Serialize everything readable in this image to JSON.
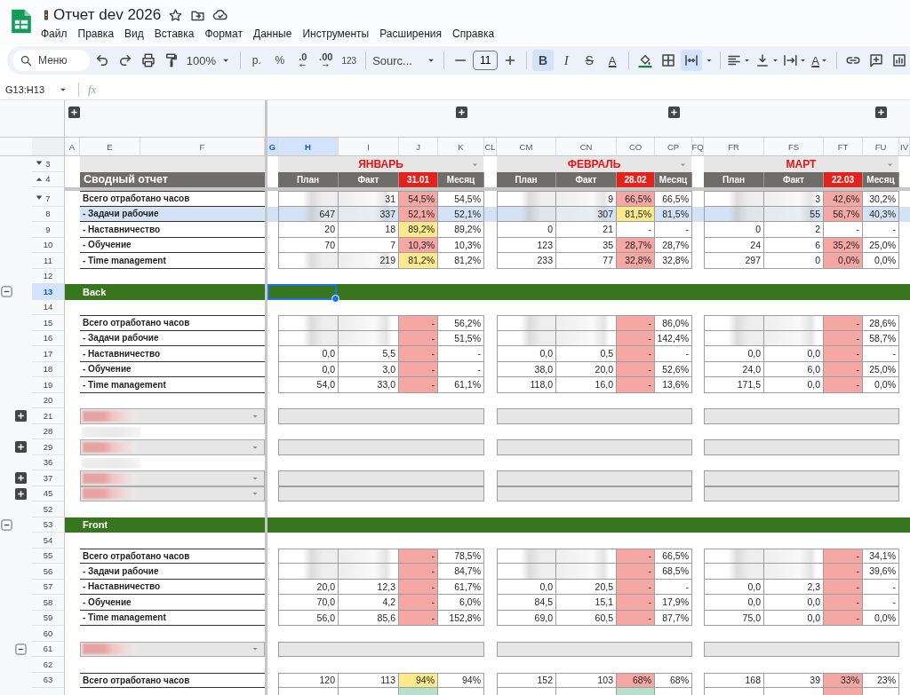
{
  "app": {
    "title": "Отчет dev 2026",
    "menu": [
      "Файл",
      "Правка",
      "Вид",
      "Вставка",
      "Формат",
      "Данные",
      "Инструменты",
      "Расширения",
      "Справка"
    ]
  },
  "toolbar": {
    "search_placeholder": "Меню",
    "zoom": "100%",
    "currency": "р.",
    "percent": "%",
    "decrease_decimals": ".0",
    "increase_decimals": ".00",
    "number_format": "123",
    "font": "Sourc...",
    "font_size": "11",
    "bold": {
      "label": "B",
      "selected": true
    },
    "italic": {
      "label": "I",
      "selected": false
    },
    "strikethrough": {
      "label": "S",
      "selected": false
    },
    "text_color": "A",
    "merge_selected": true,
    "text_rotation": "A"
  },
  "formula_bar": {
    "name_box": "G13:H13",
    "fx": "fx"
  },
  "column_groups": [
    {
      "collapsed": true
    },
    {
      "collapsed": true
    },
    {
      "collapsed": true
    },
    {
      "collapsed": true
    }
  ],
  "columns": [
    {
      "label": "A",
      "selected": false
    },
    {
      "label": "E",
      "selected": false
    },
    {
      "label": "F",
      "selected": false
    },
    {
      "label": "G",
      "selected": true
    },
    {
      "label": "H",
      "selected": true
    },
    {
      "label": "I",
      "selected": false
    },
    {
      "label": "J",
      "selected": false
    },
    {
      "label": "K",
      "selected": false
    },
    {
      "label": "CL",
      "selected": false
    },
    {
      "label": "CM",
      "selected": false
    },
    {
      "label": "CN",
      "selected": false
    },
    {
      "label": "CO",
      "selected": false
    },
    {
      "label": "CP",
      "selected": false
    },
    {
      "label": "FQ",
      "selected": false
    },
    {
      "label": "FR",
      "selected": false
    },
    {
      "label": "FS",
      "selected": false
    },
    {
      "label": "FT",
      "selected": false
    },
    {
      "label": "FU",
      "selected": false
    },
    {
      "label": "IV",
      "selected": false
    }
  ],
  "report_title": "Сводный отчет",
  "months": [
    {
      "name": "ЯНВАРЬ",
      "headers": [
        {
          "label": "План",
          "highlight": false
        },
        {
          "label": "Факт",
          "highlight": false
        },
        {
          "label": "31.01",
          "highlight": true
        },
        {
          "label": "Месяц",
          "highlight": false
        }
      ]
    },
    {
      "name": "ФЕВРАЛЬ",
      "headers": [
        {
          "label": "План",
          "highlight": false
        },
        {
          "label": "Факт",
          "highlight": false
        },
        {
          "label": "28.02",
          "highlight": true
        },
        {
          "label": "Месяц",
          "highlight": false
        }
      ]
    },
    {
      "name": "МАРТ",
      "headers": [
        {
          "label": "План",
          "highlight": false
        },
        {
          "label": "Факт",
          "highlight": false
        },
        {
          "label": "22.03",
          "highlight": true
        },
        {
          "label": "Месяц",
          "highlight": false
        }
      ]
    }
  ],
  "rows": [
    {
      "number": "3",
      "kind": "month_titles",
      "toggle": {
        "kind": "down"
      },
      "selected": false,
      "highlighted": false
    },
    {
      "number": "4",
      "kind": "month_headers",
      "toggle": {
        "kind": "up"
      },
      "selected": false,
      "highlighted": false
    },
    {
      "number": "7",
      "kind": "metric",
      "toggle": {
        "kind": "down"
      },
      "selected": false,
      "highlighted": false,
      "label": "Всего отработано часов",
      "months": [
        {
          "fact": "31",
          "pct": "54,5%",
          "month": "54,5%",
          "color": "#f4a7a3",
          "blurred": true
        },
        {
          "fact": "9",
          "pct": "66,5%",
          "month": "66,5%",
          "color": "#f4a7a3",
          "blurred": true
        },
        {
          "fact": "3",
          "pct": "42,6%",
          "month": "30,2%",
          "color": "#f4a7a3",
          "blurred": true
        }
      ]
    },
    {
      "number": "8",
      "kind": "metric",
      "selected": false,
      "highlighted": true,
      "label": "- Задачи рабочие",
      "months": [
        {
          "plan": "647",
          "fact": "337",
          "pct": "52,1%",
          "month": "52,1%",
          "color": "#f4a7a3",
          "blurred": true
        },
        {
          "fact": "307",
          "pct": "81,5%",
          "month": "81,5%",
          "color": "#fce98c",
          "blurred": true
        },
        {
          "fact": "55",
          "pct": "56,7%",
          "month": "40,3%",
          "color": "#f4a7a3",
          "blurred": true
        }
      ]
    },
    {
      "number": "9",
      "kind": "metric",
      "selected": false,
      "highlighted": false,
      "label": "- Наставничество",
      "months": [
        {
          "plan": "20",
          "fact": "18",
          "pct": "89,2%",
          "month": "89,2%",
          "color": "#fce98c",
          "blurred": false
        },
        {
          "plan": "0",
          "fact": "21",
          "pct": "-",
          "month": "-",
          "blurred": false
        },
        {
          "plan": "0",
          "fact": "2",
          "pct": "-",
          "month": "-",
          "blurred": false
        }
      ]
    },
    {
      "number": "10",
      "kind": "metric",
      "selected": false,
      "highlighted": false,
      "label": "- Обучение",
      "months": [
        {
          "plan": "70",
          "fact": "7",
          "pct": "10,3%",
          "month": "10,3%",
          "color": "#f4a7a3",
          "blurred": false
        },
        {
          "plan": "123",
          "fact": "35",
          "pct": "28,7%",
          "month": "28,7%",
          "color": "#f4a7a3",
          "blurred": false
        },
        {
          "plan": "24",
          "fact": "6",
          "pct": "35,2%",
          "month": "25,0%",
          "color": "#f4a7a3",
          "blurred": false
        }
      ]
    },
    {
      "number": "11",
      "kind": "metric",
      "selected": false,
      "highlighted": false,
      "label": "- Time management",
      "months": [
        {
          "fact": "219",
          "pct": "81,2%",
          "month": "81,2%",
          "color": "#fce98c",
          "blurred": true
        },
        {
          "plan": "233",
          "fact": "77",
          "pct": "32,8%",
          "month": "32,8%",
          "color": "#f4a7a3",
          "blurred": false
        },
        {
          "plan": "297",
          "fact": "0",
          "pct": "0,0%",
          "month": "0,0%",
          "color": "#f4a7a3",
          "blurred": false
        }
      ]
    },
    {
      "number": "12",
      "kind": "blank",
      "selected": false,
      "highlighted": false
    },
    {
      "number": "13",
      "kind": "section",
      "outline": {
        "expanded": true
      },
      "selected": true,
      "highlighted": false,
      "label": "Back"
    },
    {
      "number": "14",
      "kind": "blank",
      "selected": false,
      "highlighted": false
    },
    {
      "number": "15",
      "kind": "metric",
      "selected": false,
      "highlighted": false,
      "label": "Всего отработано часов",
      "months": [
        {
          "pct": "-",
          "month": "56,2%",
          "color": "#f4a7a3",
          "blurred": true
        },
        {
          "pct": "-",
          "month": "86,0%",
          "color": "#f4a7a3",
          "blurred": true
        },
        {
          "pct": "-",
          "month": "28,6%",
          "color": "#f4a7a3",
          "blurred": true
        }
      ]
    },
    {
      "number": "16",
      "kind": "metric",
      "selected": false,
      "highlighted": false,
      "label": "- Задачи рабочие",
      "months": [
        {
          "pct": "-",
          "month": "51,5%",
          "color": "#f4a7a3",
          "blurred": true
        },
        {
          "pct": "-",
          "month": "142,4%",
          "color": "#f4a7a3",
          "blurred": true
        },
        {
          "pct": "-",
          "month": "58,7%",
          "color": "#f4a7a3",
          "blurred": true
        }
      ]
    },
    {
      "number": "17",
      "kind": "metric",
      "selected": false,
      "highlighted": false,
      "label": "- Наставничество",
      "months": [
        {
          "plan": "0,0",
          "fact": "5,5",
          "pct": "-",
          "month": "-",
          "color": "#f4a7a3",
          "blurred": false
        },
        {
          "plan": "0,0",
          "fact": "0,5",
          "pct": "-",
          "month": "-",
          "color": "#f4a7a3",
          "blurred": false
        },
        {
          "plan": "0,0",
          "fact": "0,0",
          "pct": "-",
          "month": "-",
          "color": "#f4a7a3",
          "blurred": false
        }
      ]
    },
    {
      "number": "18",
      "kind": "metric",
      "selected": false,
      "highlighted": false,
      "label": "- Обучение",
      "months": [
        {
          "plan": "0,0",
          "fact": "3,0",
          "pct": "-",
          "month": "-",
          "color": "#f4a7a3",
          "blurred": false
        },
        {
          "plan": "38,0",
          "fact": "20,0",
          "pct": "-",
          "month": "52,6%",
          "color": "#f4a7a3",
          "blurred": false
        },
        {
          "plan": "24,0",
          "fact": "6,0",
          "pct": "-",
          "month": "25,0%",
          "color": "#f4a7a3",
          "blurred": false
        }
      ]
    },
    {
      "number": "19",
      "kind": "metric",
      "selected": false,
      "highlighted": false,
      "label": "- Time management",
      "months": [
        {
          "plan": "54,0",
          "fact": "33,0",
          "pct": "-",
          "month": "61,1%",
          "color": "#f4a7a3",
          "blurred": false
        },
        {
          "plan": "118,0",
          "fact": "16,0",
          "pct": "-",
          "month": "13,6%",
          "color": "#f4a7a3",
          "blurred": false
        },
        {
          "plan": "171,5",
          "fact": "0,0",
          "pct": "-",
          "month": "0,0%",
          "color": "#f4a7a3",
          "blurred": false
        }
      ]
    },
    {
      "number": "20",
      "kind": "blank",
      "selected": false,
      "highlighted": false
    },
    {
      "number": "21",
      "kind": "group",
      "outline": {
        "expanded": false
      },
      "blurred": true,
      "selected": false,
      "highlighted": false
    },
    {
      "number": "28",
      "kind": "blank",
      "blurred": true,
      "selected": false,
      "highlighted": false
    },
    {
      "number": "29",
      "kind": "group",
      "outline": {
        "expanded": false
      },
      "blurred": true,
      "selected": false,
      "highlighted": false
    },
    {
      "number": "36",
      "kind": "blank",
      "blurred": true,
      "selected": false,
      "highlighted": false
    },
    {
      "number": "37",
      "kind": "group",
      "outline": {
        "expanded": false
      },
      "blurred": true,
      "selected": false,
      "highlighted": false
    },
    {
      "number": "45",
      "kind": "group",
      "outline": {
        "expanded": false
      },
      "blurred": true,
      "selected": false,
      "highlighted": false
    },
    {
      "number": "52",
      "kind": "blank",
      "selected": false,
      "highlighted": false
    },
    {
      "number": "53",
      "kind": "section",
      "outline": {
        "expanded": true
      },
      "selected": false,
      "highlighted": false,
      "label": "Front"
    },
    {
      "number": "54",
      "kind": "blank",
      "selected": false,
      "highlighted": false
    },
    {
      "number": "55",
      "kind": "metric",
      "selected": false,
      "highlighted": false,
      "label": "Всего отработано часов",
      "months": [
        {
          "pct": "-",
          "month": "78,5%",
          "color": "#f4a7a3",
          "blurred": true
        },
        {
          "pct": "-",
          "month": "66,5%",
          "color": "#f4a7a3",
          "blurred": true
        },
        {
          "pct": "-",
          "month": "34,1%",
          "color": "#f4a7a3",
          "blurred": true
        }
      ]
    },
    {
      "number": "56",
      "kind": "metric",
      "selected": false,
      "highlighted": false,
      "label": "- Задачи рабочие",
      "months": [
        {
          "pct": "-",
          "month": "84,7%",
          "color": "#f4a7a3",
          "blurred": true
        },
        {
          "pct": "-",
          "month": "68,5%",
          "color": "#f4a7a3",
          "blurred": true
        },
        {
          "pct": "-",
          "month": "39,6%",
          "color": "#f4a7a3",
          "blurred": true
        }
      ]
    },
    {
      "number": "57",
      "kind": "metric",
      "selected": false,
      "highlighted": false,
      "label": "- Наставничество",
      "months": [
        {
          "plan": "20,0",
          "fact": "12,3",
          "pct": "-",
          "month": "61,7%",
          "color": "#f4a7a3",
          "blurred": false
        },
        {
          "plan": "0,0",
          "fact": "20,5",
          "pct": "-",
          "month": "-",
          "color": "#f4a7a3",
          "blurred": false
        },
        {
          "plan": "0,0",
          "fact": "2,3",
          "pct": "-",
          "month": "-",
          "color": "#f4a7a3",
          "blurred": false
        }
      ]
    },
    {
      "number": "58",
      "kind": "metric",
      "selected": false,
      "highlighted": false,
      "label": "- Обучение",
      "months": [
        {
          "plan": "70,0",
          "fact": "4,2",
          "pct": "-",
          "month": "6,0%",
          "color": "#f4a7a3",
          "blurred": false
        },
        {
          "plan": "84,5",
          "fact": "15,1",
          "pct": "-",
          "month": "17,9%",
          "color": "#f4a7a3",
          "blurred": false
        },
        {
          "plan": "0,0",
          "fact": "0,0",
          "pct": "-",
          "month": "-",
          "color": "#f4a7a3",
          "blurred": false
        }
      ]
    },
    {
      "number": "59",
      "kind": "metric",
      "selected": false,
      "highlighted": false,
      "label": "- Time management",
      "months": [
        {
          "plan": "56,0",
          "fact": "85,6",
          "pct": "-",
          "month": "152,8%",
          "color": "#f4a7a3",
          "blurred": false
        },
        {
          "plan": "69,0",
          "fact": "60,5",
          "pct": "-",
          "month": "87,7%",
          "color": "#f4a7a3",
          "blurred": false
        },
        {
          "plan": "75,0",
          "fact": "0,0",
          "pct": "-",
          "month": "0,0%",
          "color": "#f4a7a3",
          "blurred": false
        }
      ]
    },
    {
      "number": "60",
      "kind": "blank",
      "selected": false,
      "highlighted": false
    },
    {
      "number": "61",
      "kind": "group",
      "outline": {
        "expanded": true
      },
      "blurred": true,
      "selected": false,
      "highlighted": false
    },
    {
      "number": "62",
      "kind": "blank",
      "selected": false,
      "highlighted": false
    },
    {
      "number": "63",
      "kind": "metric",
      "selected": false,
      "highlighted": false,
      "label": "Всего отработано часов",
      "months": [
        {
          "plan": "120",
          "fact": "113",
          "pct": "94%",
          "month": "94%",
          "color": "#fce98c",
          "blurred": false
        },
        {
          "plan": "152",
          "fact": "103",
          "pct": "68%",
          "month": "68%",
          "color": "#f4a7a3",
          "blurred": false
        },
        {
          "plan": "168",
          "fact": "39",
          "pct": "33%",
          "month": "23%",
          "color": "#f4a7a3",
          "blurred": false
        }
      ]
    },
    {
      "kind": "metric",
      "selected": false,
      "highlighted": false,
      "months": [
        {
          "color": "#b7e1cd",
          "blurred": false
        },
        {
          "color": "#b7e1cd",
          "blurred": false
        },
        {
          "color": "#f4a7a3",
          "blurred": false
        }
      ]
    }
  ]
}
